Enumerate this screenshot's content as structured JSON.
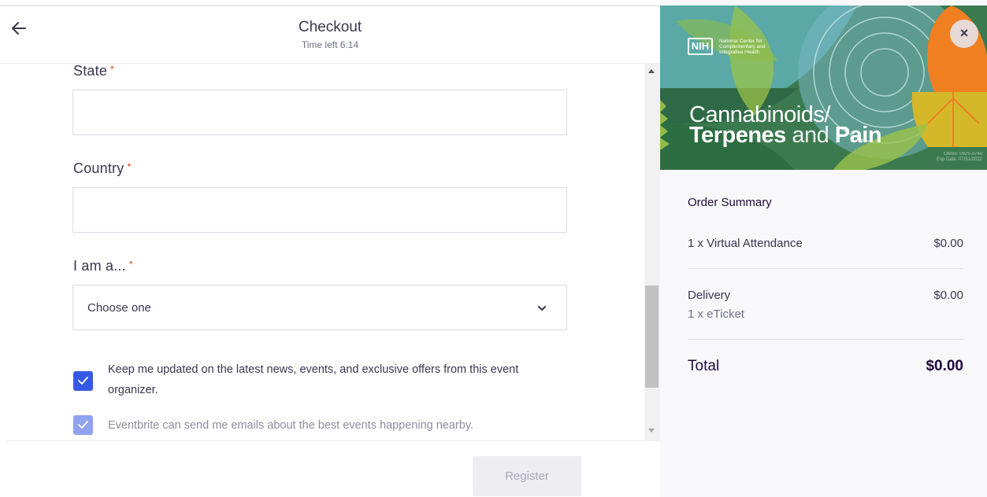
{
  "header": {
    "title": "Checkout",
    "timer": "Time left 6:14"
  },
  "form": {
    "state": {
      "label": "State",
      "required": "*",
      "value": ""
    },
    "country": {
      "label": "Country",
      "required": "*",
      "value": ""
    },
    "role": {
      "label": "I am a...",
      "required": "*",
      "selected": "Choose one"
    },
    "optin_organizer": {
      "text": "Keep me updated on the latest news, events, and exclusive offers from this event organizer.",
      "checked": true
    },
    "optin_eventbrite": {
      "text": "Eventbrite can send me emails about the best events happening nearby.",
      "checked": true
    }
  },
  "footer": {
    "register_label": "Register"
  },
  "banner": {
    "logo_text": "NIH",
    "org_name": "National Center for Complementary and Integrative Health",
    "title_line1": "Cannabinoids/",
    "title_line2_a": "Terpenes",
    "title_line2_b": " and ",
    "title_line2_c": "Pain",
    "omb_line1": "OMB#: 0925-0740",
    "omb_line2": "Exp Date: 07/31/2022"
  },
  "summary": {
    "title": "Order Summary",
    "items": [
      {
        "label": "1 x Virtual Attendance",
        "amount": "$0.00"
      }
    ],
    "delivery": {
      "label": "Delivery",
      "sub": "1 x eTicket",
      "amount": "$0.00"
    },
    "total": {
      "label": "Total",
      "amount": "$0.00"
    }
  },
  "colors": {
    "accent": "#3659e3",
    "required": "#d1410c",
    "banner_green": "#3b7a4f",
    "banner_orange": "#f07f22",
    "banner_teal": "#5fa9b3"
  },
  "icons": [
    "back-arrow-icon",
    "chevron-down-icon",
    "check-icon",
    "close-icon"
  ]
}
